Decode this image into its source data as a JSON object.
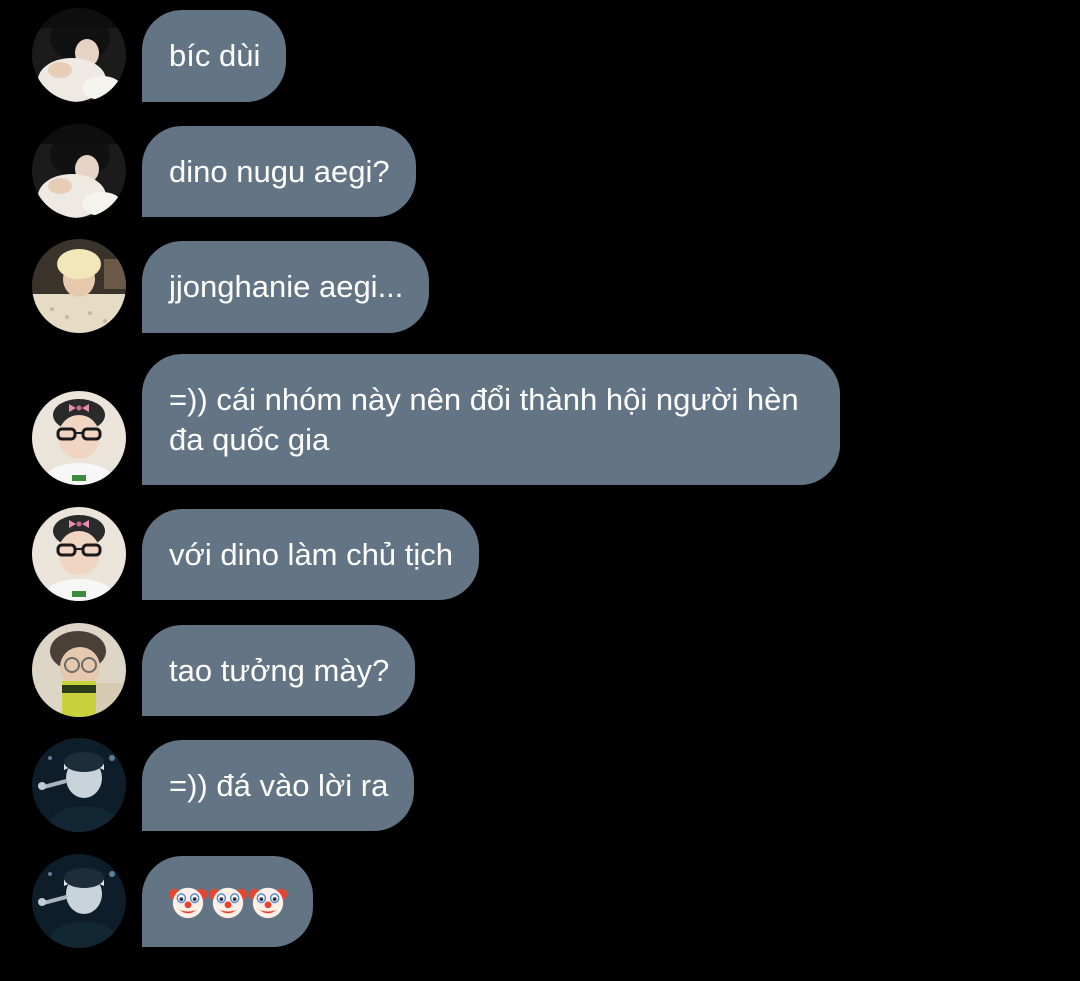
{
  "colors": {
    "background": "#000000",
    "bubble": "#637484",
    "text": "#ffffff"
  },
  "messages": [
    {
      "avatar": "photo-avatar-1",
      "text": "bíc dùi"
    },
    {
      "avatar": "photo-avatar-1",
      "text": "dino nugu aegi?"
    },
    {
      "avatar": "photo-avatar-2",
      "text": "jjonghanie aegi..."
    },
    {
      "avatar": "photo-avatar-3",
      "text": "=)) cái nhóm này nên đổi thành hội người hèn đa quốc gia"
    },
    {
      "avatar": "photo-avatar-3",
      "text": "với dino làm chủ tịch"
    },
    {
      "avatar": "photo-avatar-4",
      "text": "tao tưởng mày?"
    },
    {
      "avatar": "photo-avatar-5",
      "text": "=)) đá vào lời ra"
    },
    {
      "avatar": "photo-avatar-5",
      "emoji": [
        "clown-face-icon",
        "clown-face-icon",
        "clown-face-icon"
      ]
    }
  ]
}
